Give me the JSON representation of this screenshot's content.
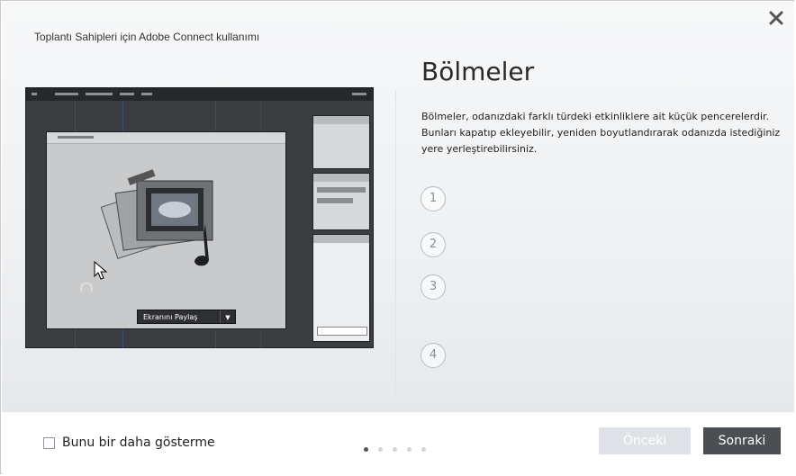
{
  "dialog": {
    "title": "Toplantı Sahipleri için Adobe Connect kullanımı",
    "close_icon": "close-icon"
  },
  "content": {
    "heading": "Bölmeler",
    "description": "Bölmeler, odanızdaki farklı türdeki etkinliklere ait küçük pencerelerdir. Bunları kapatıp ekleyebilir, yeniden boyutlandırarak odanızda istediğiniz yere yerleştirebilirsiniz.",
    "steps": [
      "1",
      "2",
      "3",
      "4"
    ]
  },
  "illustration": {
    "share_button_label": "Ekranını Paylaş",
    "share_caret_icon": "chevron-down-icon"
  },
  "footer": {
    "checkbox_label": "Bunu bir daha gösterme",
    "checkbox_checked": false,
    "page_dots": {
      "total": 5,
      "active": 1
    },
    "prev_label": "Önceki",
    "next_label": "Sonraki"
  },
  "colors": {
    "next_button_bg": "#4b4e53",
    "prev_button_bg": "#dfe2e6",
    "background": "#eef0f2"
  }
}
